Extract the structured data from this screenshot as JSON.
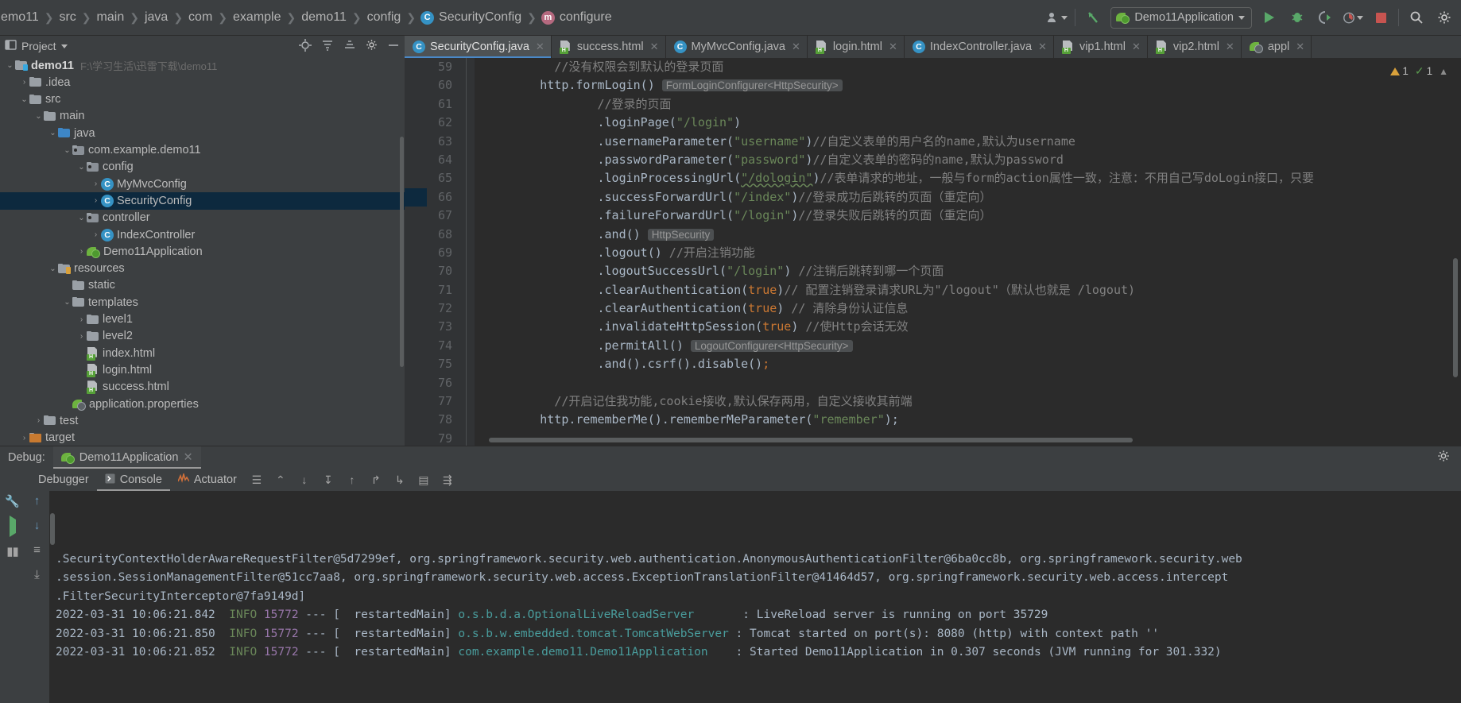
{
  "toolbar": {
    "breadcrumbs": [
      {
        "label": "emo11",
        "icon": ""
      },
      {
        "label": "src",
        "icon": ""
      },
      {
        "label": "main",
        "icon": ""
      },
      {
        "label": "java",
        "icon": ""
      },
      {
        "label": "com",
        "icon": ""
      },
      {
        "label": "example",
        "icon": ""
      },
      {
        "label": "demo11",
        "icon": ""
      },
      {
        "label": "config",
        "icon": ""
      },
      {
        "label": "SecurityConfig",
        "icon": "class-icon"
      },
      {
        "label": "configure",
        "icon": "method-icon"
      }
    ],
    "run_config": "Demo11Application",
    "icons": [
      "user-icon",
      "vcs-update-icon",
      "run-icon",
      "debug-icon",
      "run-coverage-icon",
      "profiler-icon",
      "stop-icon",
      "search-icon",
      "settings-icon"
    ]
  },
  "project_panel": {
    "title": "Project",
    "tree": [
      {
        "label": "demo11",
        "path": "F:\\学习生活\\迅雷下载\\demo11",
        "indent": 0,
        "arrow": "down",
        "icon": "module-folder",
        "bold": true
      },
      {
        "label": ".idea",
        "indent": 1,
        "arrow": "right",
        "icon": "folder"
      },
      {
        "label": "src",
        "indent": 1,
        "arrow": "down",
        "icon": "folder"
      },
      {
        "label": "main",
        "indent": 2,
        "arrow": "down",
        "icon": "folder"
      },
      {
        "label": "java",
        "indent": 3,
        "arrow": "down",
        "icon": "source-folder"
      },
      {
        "label": "com.example.demo11",
        "indent": 4,
        "arrow": "down",
        "icon": "package"
      },
      {
        "label": "config",
        "indent": 5,
        "arrow": "down",
        "icon": "package"
      },
      {
        "label": "MyMvcConfig",
        "indent": 6,
        "arrow": "right",
        "icon": "class"
      },
      {
        "label": "SecurityConfig",
        "indent": 6,
        "arrow": "right",
        "icon": "class",
        "selected": true
      },
      {
        "label": "controller",
        "indent": 5,
        "arrow": "down",
        "icon": "package"
      },
      {
        "label": "IndexController",
        "indent": 6,
        "arrow": "right",
        "icon": "class"
      },
      {
        "label": "Demo11Application",
        "indent": 5,
        "arrow": "right",
        "icon": "spring-run"
      },
      {
        "label": "resources",
        "indent": 3,
        "arrow": "down",
        "icon": "resource-folder"
      },
      {
        "label": "static",
        "indent": 4,
        "arrow": "none",
        "icon": "folder"
      },
      {
        "label": "templates",
        "indent": 4,
        "arrow": "down",
        "icon": "folder"
      },
      {
        "label": "level1",
        "indent": 5,
        "arrow": "right",
        "icon": "folder"
      },
      {
        "label": "level2",
        "indent": 5,
        "arrow": "right",
        "icon": "folder"
      },
      {
        "label": "index.html",
        "indent": 5,
        "arrow": "none",
        "icon": "html"
      },
      {
        "label": "login.html",
        "indent": 5,
        "arrow": "none",
        "icon": "html"
      },
      {
        "label": "success.html",
        "indent": 5,
        "arrow": "none",
        "icon": "html"
      },
      {
        "label": "application.properties",
        "indent": 4,
        "arrow": "none",
        "icon": "spring"
      },
      {
        "label": "test",
        "indent": 2,
        "arrow": "right",
        "icon": "folder"
      },
      {
        "label": "target",
        "indent": 1,
        "arrow": "right",
        "icon": "target-folder"
      }
    ]
  },
  "editor": {
    "tabs": [
      {
        "label": "SecurityConfig.java",
        "icon": "class-icon",
        "active": true
      },
      {
        "label": "success.html",
        "icon": "html-icon",
        "active": false
      },
      {
        "label": "MyMvcConfig.java",
        "icon": "class-icon",
        "active": false
      },
      {
        "label": "login.html",
        "icon": "html-icon",
        "active": false
      },
      {
        "label": "IndexController.java",
        "icon": "class-icon",
        "active": false
      },
      {
        "label": "vip1.html",
        "icon": "html-icon",
        "active": false
      },
      {
        "label": "vip2.html",
        "icon": "html-icon",
        "active": false
      },
      {
        "label": "appl",
        "icon": "spring-icon",
        "active": false
      }
    ],
    "inspections": {
      "warnings": "1",
      "oks": "1"
    },
    "first_line": 59,
    "lines": [
      {
        "n": 59,
        "parts": [
          {
            "t": "          ",
            "c": "txt"
          },
          {
            "t": "//没有权限会到默认的登录页面",
            "c": "com"
          }
        ]
      },
      {
        "n": 60,
        "parts": [
          {
            "t": "        ",
            "c": "txt"
          },
          {
            "t": "http.formLogin()",
            "c": "txt"
          },
          {
            "t": " ",
            "c": "txt"
          },
          {
            "t": "FormLoginConfigurer<HttpSecurity>",
            "c": "hint"
          }
        ]
      },
      {
        "n": 61,
        "parts": [
          {
            "t": "                ",
            "c": "txt"
          },
          {
            "t": "//登录的页面",
            "c": "com"
          }
        ]
      },
      {
        "n": 62,
        "parts": [
          {
            "t": "                ",
            "c": "txt"
          },
          {
            "t": ".loginPage(",
            "c": "txt"
          },
          {
            "t": "\"/login\"",
            "c": "str"
          },
          {
            "t": ")",
            "c": "txt"
          }
        ]
      },
      {
        "n": 63,
        "parts": [
          {
            "t": "                ",
            "c": "txt"
          },
          {
            "t": ".usernameParameter(",
            "c": "txt"
          },
          {
            "t": "\"username\"",
            "c": "str"
          },
          {
            "t": ")",
            "c": "txt"
          },
          {
            "t": "//自定义表单的用户名的name,默认为username",
            "c": "com"
          }
        ]
      },
      {
        "n": 64,
        "parts": [
          {
            "t": "                ",
            "c": "txt"
          },
          {
            "t": ".passwordParameter(",
            "c": "txt"
          },
          {
            "t": "\"password\"",
            "c": "str"
          },
          {
            "t": ")",
            "c": "txt"
          },
          {
            "t": "//自定义表单的密码的name,默认为password",
            "c": "com"
          }
        ]
      },
      {
        "n": 65,
        "parts": [
          {
            "t": "                ",
            "c": "txt"
          },
          {
            "t": ".loginProcessingUrl(",
            "c": "txt"
          },
          {
            "t": "\"/dologin\"",
            "c": "str-squig"
          },
          {
            "t": ")",
            "c": "txt"
          },
          {
            "t": "//表单请求的地址，一般与form的action属性一致，注意：不用自己写doLogin接口，只要",
            "c": "com"
          }
        ]
      },
      {
        "n": 66,
        "parts": [
          {
            "t": "                ",
            "c": "txt"
          },
          {
            "t": ".successForwardUrl(",
            "c": "txt"
          },
          {
            "t": "\"/index\"",
            "c": "str"
          },
          {
            "t": ")",
            "c": "txt"
          },
          {
            "t": "//登录成功后跳转的页面（重定向）",
            "c": "com"
          }
        ]
      },
      {
        "n": 67,
        "parts": [
          {
            "t": "                ",
            "c": "txt"
          },
          {
            "t": ".failureForwardUrl(",
            "c": "txt"
          },
          {
            "t": "\"/login\"",
            "c": "str"
          },
          {
            "t": ")",
            "c": "txt"
          },
          {
            "t": "//登录失败后跳转的页面（重定向）",
            "c": "com"
          }
        ]
      },
      {
        "n": 68,
        "parts": [
          {
            "t": "                ",
            "c": "txt"
          },
          {
            "t": ".and()",
            "c": "txt"
          },
          {
            "t": " ",
            "c": "txt"
          },
          {
            "t": "HttpSecurity",
            "c": "hint"
          }
        ]
      },
      {
        "n": 69,
        "parts": [
          {
            "t": "                ",
            "c": "txt"
          },
          {
            "t": ".logout()",
            "c": "txt"
          },
          {
            "t": " //开启注销功能",
            "c": "com"
          }
        ]
      },
      {
        "n": 70,
        "parts": [
          {
            "t": "                ",
            "c": "txt"
          },
          {
            "t": ".logoutSuccessUrl(",
            "c": "txt"
          },
          {
            "t": "\"/login\"",
            "c": "str"
          },
          {
            "t": ")",
            "c": "txt"
          },
          {
            "t": " //注销后跳转到哪一个页面",
            "c": "com"
          }
        ]
      },
      {
        "n": 71,
        "parts": [
          {
            "t": "                ",
            "c": "txt"
          },
          {
            "t": ".clearAuthentication(",
            "c": "txt"
          },
          {
            "t": "true",
            "c": "kw"
          },
          {
            "t": ")",
            "c": "txt"
          },
          {
            "t": "// 配置注销登录请求URL为\"/logout\"（默认也就是 /logout)",
            "c": "com"
          }
        ]
      },
      {
        "n": 72,
        "parts": [
          {
            "t": "                ",
            "c": "txt"
          },
          {
            "t": ".clearAuthentication(",
            "c": "txt"
          },
          {
            "t": "true",
            "c": "kw"
          },
          {
            "t": ")",
            "c": "txt"
          },
          {
            "t": " // 清除身份认证信息",
            "c": "com"
          }
        ]
      },
      {
        "n": 73,
        "parts": [
          {
            "t": "                ",
            "c": "txt"
          },
          {
            "t": ".invalidateHttpSession(",
            "c": "txt"
          },
          {
            "t": "true",
            "c": "kw"
          },
          {
            "t": ")",
            "c": "txt"
          },
          {
            "t": " //使Http会话无效",
            "c": "com"
          }
        ]
      },
      {
        "n": 74,
        "parts": [
          {
            "t": "                ",
            "c": "txt"
          },
          {
            "t": ".permitAll()",
            "c": "txt"
          },
          {
            "t": " ",
            "c": "txt"
          },
          {
            "t": "LogoutConfigurer<HttpSecurity>",
            "c": "hint"
          }
        ]
      },
      {
        "n": 75,
        "parts": [
          {
            "t": "                ",
            "c": "txt"
          },
          {
            "t": ".and().csrf().disable()",
            "c": "txt"
          },
          {
            "t": ";",
            "c": "kw"
          }
        ]
      },
      {
        "n": 76,
        "parts": []
      },
      {
        "n": 77,
        "parts": [
          {
            "t": "          ",
            "c": "txt"
          },
          {
            "t": "//开启记住我功能,cookie接收,默认保存两用，自定义接收其前端",
            "c": "com"
          }
        ]
      },
      {
        "n": 78,
        "parts": [
          {
            "t": "        ",
            "c": "txt"
          },
          {
            "t": "http.rememberMe().rememberMeParameter(",
            "c": "txt"
          },
          {
            "t": "\"remember\"",
            "c": "str"
          },
          {
            "t": ");",
            "c": "txt"
          }
        ]
      },
      {
        "n": 79,
        "parts": []
      }
    ]
  },
  "debug_panel": {
    "title": "Debug:",
    "session": "Demo11Application",
    "tabs": [
      {
        "label": "Debugger",
        "icon": "debugger-icon",
        "active": false
      },
      {
        "label": "Console",
        "icon": "console-icon",
        "active": true
      },
      {
        "label": "Actuator",
        "icon": "actuator-icon",
        "active": false
      }
    ],
    "console_lines": [
      [
        {
          "t": ".SecurityContextHolderAwareRequestFilter@5d7299ef, org.springframework.security.web.authentication.AnonymousAuthenticationFilter@6ba0cc8b, org.springframework.security.web",
          "c": "txt"
        }
      ],
      [
        {
          "t": ".session.SessionManagementFilter@51cc7aa8, org.springframework.security.web.access.ExceptionTranslationFilter@41464d57, org.springframework.security.web.access.intercept",
          "c": "txt"
        }
      ],
      [
        {
          "t": ".FilterSecurityInterceptor@7fa9149d]",
          "c": "txt"
        }
      ],
      [
        {
          "t": "2022-03-31 10:06:21.842  ",
          "c": "txt"
        },
        {
          "t": "INFO",
          "c": "info"
        },
        {
          "t": " ",
          "c": "txt"
        },
        {
          "t": "15772",
          "c": "pid"
        },
        {
          "t": " --- [  restartedMain] ",
          "c": "txt"
        },
        {
          "t": "o.s.b.d.a.OptionalLiveReloadServer",
          "c": "log"
        },
        {
          "t": "       : LiveReload server is running on port 35729",
          "c": "txt"
        }
      ],
      [
        {
          "t": "2022-03-31 10:06:21.850  ",
          "c": "txt"
        },
        {
          "t": "INFO",
          "c": "info"
        },
        {
          "t": " ",
          "c": "txt"
        },
        {
          "t": "15772",
          "c": "pid"
        },
        {
          "t": " --- [  restartedMain] ",
          "c": "txt"
        },
        {
          "t": "o.s.b.w.embedded.tomcat.TomcatWebServer",
          "c": "log"
        },
        {
          "t": " : Tomcat started on port(s): 8080 (http) with context path ''",
          "c": "txt"
        }
      ],
      [
        {
          "t": "2022-03-31 10:06:21.852  ",
          "c": "txt"
        },
        {
          "t": "INFO",
          "c": "info"
        },
        {
          "t": " ",
          "c": "txt"
        },
        {
          "t": "15772",
          "c": "pid"
        },
        {
          "t": " --- [  restartedMain] ",
          "c": "txt"
        },
        {
          "t": "com.example.demo11.Demo11Application",
          "c": "log"
        },
        {
          "t": "    : Started Demo11Application in 0.307 seconds (JVM running for 301.332)",
          "c": "txt"
        }
      ]
    ]
  }
}
